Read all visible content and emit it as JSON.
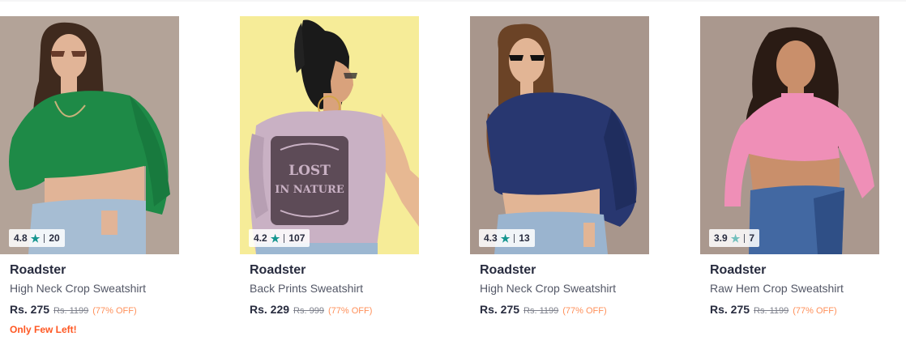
{
  "colors": {
    "star_teal": "#14958f",
    "star_light": "#72bfbc",
    "discount_orange": "#ff905a",
    "urgent_red": "#ff5722",
    "text_dark": "#282c3f",
    "text_grey": "#535766"
  },
  "products": [
    {
      "brand": "Roadster",
      "name": "Back Prints Sweatshirt",
      "price": "Rs. 229",
      "mrp": "Rs. 999",
      "discount": "(77% OFF)",
      "rating": "4.2",
      "rating_count": "107",
      "star_icon": "star-icon",
      "note": ""
    },
    {
      "brand": "Roadster",
      "name": "High Neck Crop Sweatshirt",
      "price": "Rs. 275",
      "mrp": "Rs. 1199",
      "discount": "(77% OFF)",
      "rating": "4.3",
      "rating_count": "13",
      "star_icon": "star-icon",
      "note": ""
    },
    {
      "brand": "Roadster",
      "name": "Raw Hem Crop Sweatshirt",
      "price": "Rs. 275",
      "mrp": "Rs. 1199",
      "discount": "(77% OFF)",
      "rating": "3.9",
      "rating_count": "7",
      "star_icon": "star-icon",
      "note": ""
    },
    {
      "brand": "Roadster",
      "name": "High Neck Crop Sweatshirt",
      "price": "Rs. 275",
      "mrp": "Rs. 1199",
      "discount": "(77% OFF)",
      "rating": "4.8",
      "rating_count": "20",
      "star_icon": "star-icon",
      "note": "Only Few Left!"
    }
  ]
}
